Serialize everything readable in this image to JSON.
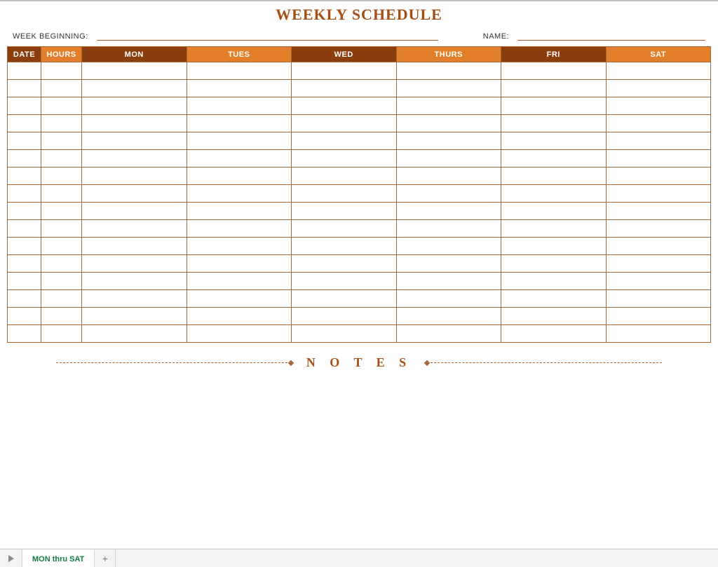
{
  "title": "WEEKLY SCHEDULE",
  "meta": {
    "week_label": "WEEK BEGINNING:",
    "week_value": "",
    "name_label": "NAME:",
    "name_value": ""
  },
  "columns": [
    {
      "label": "DATE",
      "shade": "dark",
      "width": "col-date"
    },
    {
      "label": "HOURS",
      "shade": "light",
      "width": "col-hours"
    },
    {
      "label": "MON",
      "shade": "dark",
      "width": "col-day"
    },
    {
      "label": "TUES",
      "shade": "light",
      "width": "col-day"
    },
    {
      "label": "WED",
      "shade": "dark",
      "width": "col-day"
    },
    {
      "label": "THURS",
      "shade": "light",
      "width": "col-day"
    },
    {
      "label": "FRI",
      "shade": "dark",
      "width": "col-day"
    },
    {
      "label": "SAT",
      "shade": "light",
      "width": "col-day"
    }
  ],
  "row_count": 16,
  "notes_label": "N O T E S",
  "tabs": {
    "active": "MON thru SAT"
  }
}
